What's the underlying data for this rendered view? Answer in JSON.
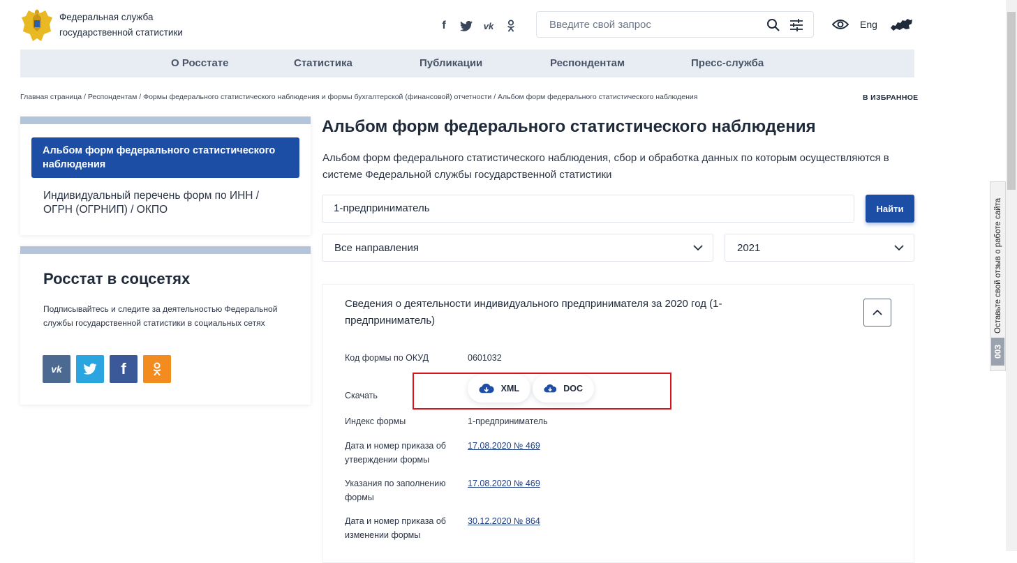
{
  "header": {
    "org_name_line1": "Федеральная служба",
    "org_name_line2": "государственной статистики",
    "social_icons": [
      "facebook-icon",
      "twitter-icon",
      "vk-icon",
      "odnoklassniki-icon"
    ],
    "search_placeholder": "Введите свой запрос",
    "lang": "Eng"
  },
  "nav": {
    "items": [
      "О Росстате",
      "Статистика",
      "Публикации",
      "Респондентам",
      "Пресс-служба"
    ]
  },
  "breadcrumb": "Главная страница / Респондентам / Формы федерального статистического наблюдения и формы бухгалтерской (финансовой) отчетности / Альбом форм федерального статистического наблюдения",
  "favorites_label": "В ИЗБРАННОЕ",
  "sidebar": {
    "active_item": "Альбом форм федерального статистического наблюдения",
    "item2": "Индивидуальный перечень форм по ИНН / ОГРН (ОГРНИП) / ОКПО",
    "social_title": "Росстат в соцсетях",
    "social_text": "Подписывайтесь и следите за деятельностью Федеральной службы государственной статистики в социальных сетях",
    "social_buttons": [
      {
        "name": "vk",
        "color": "#4c6a91"
      },
      {
        "name": "twitter",
        "color": "#2ba5e0"
      },
      {
        "name": "facebook",
        "color": "#3b5998"
      },
      {
        "name": "odnoklassniki",
        "color": "#f28c1e"
      }
    ]
  },
  "main": {
    "title": "Альбом форм федерального статистического наблюдения",
    "intro": "Альбом форм федерального статистического наблюдения, сбор и обработка данных по которым осуществляются в системе Федеральной службы государственной статистики",
    "query_value": "1-предприниматель",
    "find_label": "Найти",
    "direction_select": "Все направления",
    "year_select": "2021",
    "result": {
      "title": "Сведения о деятельности индивидуального предпринимателя за 2020 год (1-предприниматель)",
      "okud_label": "Код формы по ОКУД",
      "okud_value": "0601032",
      "download_label": "Скачать",
      "xml_label": "XML",
      "doc_label": "DOC",
      "index_label": "Индекс формы",
      "index_value": "1-предприниматель",
      "approval_label": "Дата и номер приказа об утверждении формы",
      "approval_value": "17.08.2020 № 469",
      "instructions_label": "Указания по заполнению формы",
      "instructions_value": "17.08.2020 № 469",
      "change_label": "Дата и номер приказа об изменении формы",
      "change_value": "30.12.2020 № 864"
    }
  },
  "feedback": {
    "text": "Оставьте свой отзыв о работе сайта",
    "badge": "003"
  },
  "colors": {
    "brand_blue": "#1d4ea6",
    "nav_bg": "#e8edf4",
    "highlight_red": "#d9141c"
  }
}
